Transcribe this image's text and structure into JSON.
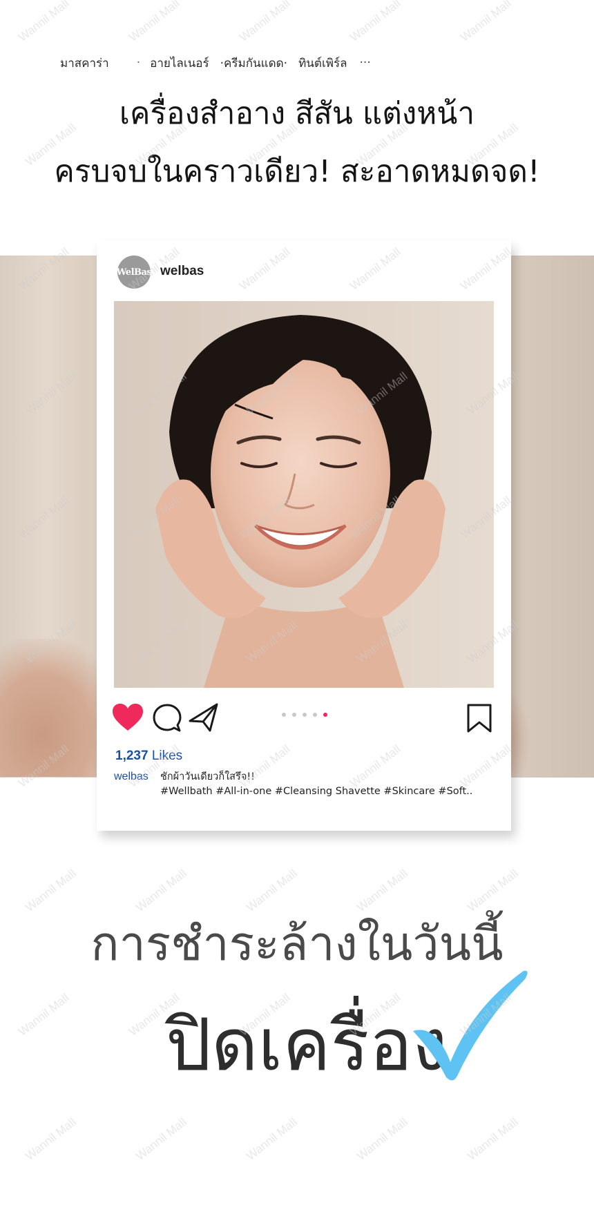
{
  "tags": {
    "items": [
      "มาสคาร่า",
      "อายไลเนอร์",
      "·ครีมกันแดด·",
      "ทินต์เพิร์ล"
    ],
    "separator": "·",
    "more": "···"
  },
  "headline": {
    "line1": "เครื่องสำอาง สีสัน แต่งหน้า",
    "line2": "ครบจบในคราวเดียว! สะอาดหมดจด!"
  },
  "post": {
    "avatar_text": "WelBas",
    "username": "welbas",
    "likes_count": "1,237",
    "likes_label": "Likes",
    "caption_user": "welbas",
    "caption_line1": "ชักผ้าวันเดียวก็ใสรึจ!!",
    "caption_line2": "#Wellbath #All-in-one #Cleansing Shavette #Skincare #Soft..",
    "carousel_total": 5,
    "carousel_active": 5,
    "heart_color": "#f0295d",
    "link_color": "#1a4fa8"
  },
  "bottom": {
    "subtitle": "การชำระล้างในวันนี้",
    "title": "ปิดเครื่อง",
    "check_color": "#5ec3f2"
  },
  "watermark": "Wannil Mall"
}
